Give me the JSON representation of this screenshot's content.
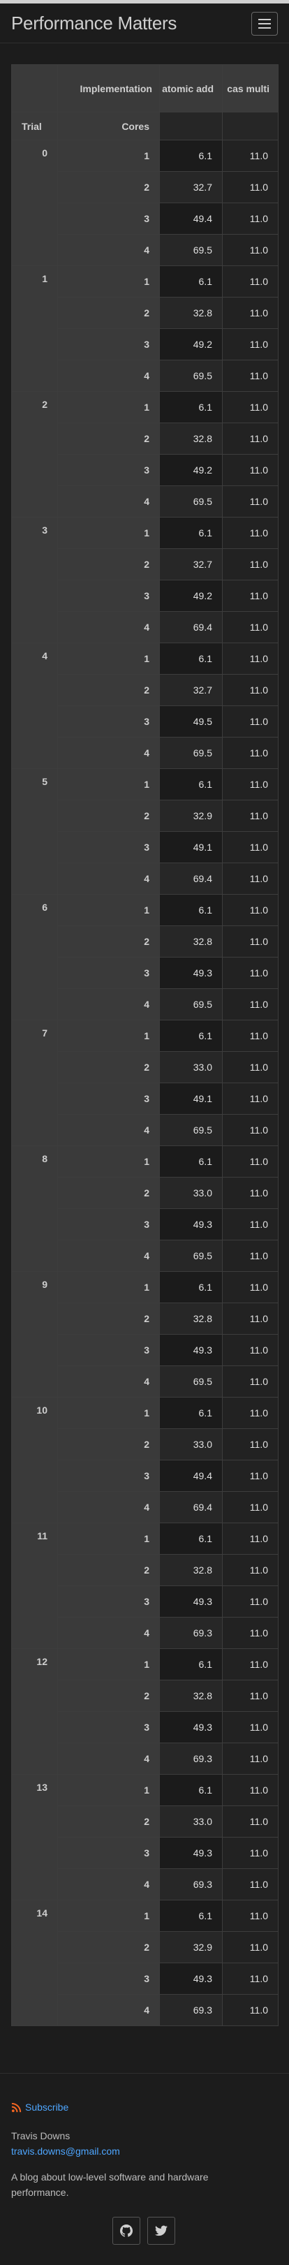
{
  "site": {
    "title": "Performance Matters"
  },
  "table": {
    "header_row1": {
      "trial": "",
      "implementation": "Implementation",
      "atomic_add": "atomic add",
      "cas_multi": "cas multi"
    },
    "header_row2": {
      "trial": "Trial",
      "cores": "Cores"
    },
    "trials": [
      {
        "trial": "0",
        "rows": [
          {
            "cores": "1",
            "atomic": "6.1",
            "cas": "11.0"
          },
          {
            "cores": "2",
            "atomic": "32.7",
            "cas": "11.0"
          },
          {
            "cores": "3",
            "atomic": "49.4",
            "cas": "11.0"
          },
          {
            "cores": "4",
            "atomic": "69.5",
            "cas": "11.0"
          }
        ]
      },
      {
        "trial": "1",
        "rows": [
          {
            "cores": "1",
            "atomic": "6.1",
            "cas": "11.0"
          },
          {
            "cores": "2",
            "atomic": "32.8",
            "cas": "11.0"
          },
          {
            "cores": "3",
            "atomic": "49.2",
            "cas": "11.0"
          },
          {
            "cores": "4",
            "atomic": "69.5",
            "cas": "11.0"
          }
        ]
      },
      {
        "trial": "2",
        "rows": [
          {
            "cores": "1",
            "atomic": "6.1",
            "cas": "11.0"
          },
          {
            "cores": "2",
            "atomic": "32.8",
            "cas": "11.0"
          },
          {
            "cores": "3",
            "atomic": "49.2",
            "cas": "11.0"
          },
          {
            "cores": "4",
            "atomic": "69.5",
            "cas": "11.0"
          }
        ]
      },
      {
        "trial": "3",
        "rows": [
          {
            "cores": "1",
            "atomic": "6.1",
            "cas": "11.0"
          },
          {
            "cores": "2",
            "atomic": "32.7",
            "cas": "11.0"
          },
          {
            "cores": "3",
            "atomic": "49.2",
            "cas": "11.0"
          },
          {
            "cores": "4",
            "atomic": "69.4",
            "cas": "11.0"
          }
        ]
      },
      {
        "trial": "4",
        "rows": [
          {
            "cores": "1",
            "atomic": "6.1",
            "cas": "11.0"
          },
          {
            "cores": "2",
            "atomic": "32.7",
            "cas": "11.0"
          },
          {
            "cores": "3",
            "atomic": "49.5",
            "cas": "11.0"
          },
          {
            "cores": "4",
            "atomic": "69.5",
            "cas": "11.0"
          }
        ]
      },
      {
        "trial": "5",
        "rows": [
          {
            "cores": "1",
            "atomic": "6.1",
            "cas": "11.0"
          },
          {
            "cores": "2",
            "atomic": "32.9",
            "cas": "11.0"
          },
          {
            "cores": "3",
            "atomic": "49.1",
            "cas": "11.0"
          },
          {
            "cores": "4",
            "atomic": "69.4",
            "cas": "11.0"
          }
        ]
      },
      {
        "trial": "6",
        "rows": [
          {
            "cores": "1",
            "atomic": "6.1",
            "cas": "11.0"
          },
          {
            "cores": "2",
            "atomic": "32.8",
            "cas": "11.0"
          },
          {
            "cores": "3",
            "atomic": "49.3",
            "cas": "11.0"
          },
          {
            "cores": "4",
            "atomic": "69.5",
            "cas": "11.0"
          }
        ]
      },
      {
        "trial": "7",
        "rows": [
          {
            "cores": "1",
            "atomic": "6.1",
            "cas": "11.0"
          },
          {
            "cores": "2",
            "atomic": "33.0",
            "cas": "11.0"
          },
          {
            "cores": "3",
            "atomic": "49.1",
            "cas": "11.0"
          },
          {
            "cores": "4",
            "atomic": "69.5",
            "cas": "11.0"
          }
        ]
      },
      {
        "trial": "8",
        "rows": [
          {
            "cores": "1",
            "atomic": "6.1",
            "cas": "11.0"
          },
          {
            "cores": "2",
            "atomic": "33.0",
            "cas": "11.0"
          },
          {
            "cores": "3",
            "atomic": "49.3",
            "cas": "11.0"
          },
          {
            "cores": "4",
            "atomic": "69.5",
            "cas": "11.0"
          }
        ]
      },
      {
        "trial": "9",
        "rows": [
          {
            "cores": "1",
            "atomic": "6.1",
            "cas": "11.0"
          },
          {
            "cores": "2",
            "atomic": "32.8",
            "cas": "11.0"
          },
          {
            "cores": "3",
            "atomic": "49.3",
            "cas": "11.0"
          },
          {
            "cores": "4",
            "atomic": "69.5",
            "cas": "11.0"
          }
        ]
      },
      {
        "trial": "10",
        "rows": [
          {
            "cores": "1",
            "atomic": "6.1",
            "cas": "11.0"
          },
          {
            "cores": "2",
            "atomic": "33.0",
            "cas": "11.0"
          },
          {
            "cores": "3",
            "atomic": "49.4",
            "cas": "11.0"
          },
          {
            "cores": "4",
            "atomic": "69.4",
            "cas": "11.0"
          }
        ]
      },
      {
        "trial": "11",
        "rows": [
          {
            "cores": "1",
            "atomic": "6.1",
            "cas": "11.0"
          },
          {
            "cores": "2",
            "atomic": "32.8",
            "cas": "11.0"
          },
          {
            "cores": "3",
            "atomic": "49.3",
            "cas": "11.0"
          },
          {
            "cores": "4",
            "atomic": "69.3",
            "cas": "11.0"
          }
        ]
      },
      {
        "trial": "12",
        "rows": [
          {
            "cores": "1",
            "atomic": "6.1",
            "cas": "11.0"
          },
          {
            "cores": "2",
            "atomic": "32.8",
            "cas": "11.0"
          },
          {
            "cores": "3",
            "atomic": "49.3",
            "cas": "11.0"
          },
          {
            "cores": "4",
            "atomic": "69.3",
            "cas": "11.0"
          }
        ]
      },
      {
        "trial": "13",
        "rows": [
          {
            "cores": "1",
            "atomic": "6.1",
            "cas": "11.0"
          },
          {
            "cores": "2",
            "atomic": "33.0",
            "cas": "11.0"
          },
          {
            "cores": "3",
            "atomic": "49.3",
            "cas": "11.0"
          },
          {
            "cores": "4",
            "atomic": "69.3",
            "cas": "11.0"
          }
        ]
      },
      {
        "trial": "14",
        "rows": [
          {
            "cores": "1",
            "atomic": "6.1",
            "cas": "11.0"
          },
          {
            "cores": "2",
            "atomic": "32.9",
            "cas": "11.0"
          },
          {
            "cores": "3",
            "atomic": "49.3",
            "cas": "11.0"
          },
          {
            "cores": "4",
            "atomic": "69.3",
            "cas": "11.0"
          }
        ]
      }
    ]
  },
  "footer": {
    "subscribe_label": "Subscribe",
    "author": "Travis Downs",
    "email": "travis.downs@gmail.com",
    "description": "A blog about low-level software and hardware performance.",
    "social": [
      "github-icon",
      "twitter-icon"
    ]
  },
  "colors": {
    "link": "#4ea6ff",
    "rss": "#f26522",
    "background": "#1c1c1c",
    "header_cell": "#3a3a3a"
  }
}
